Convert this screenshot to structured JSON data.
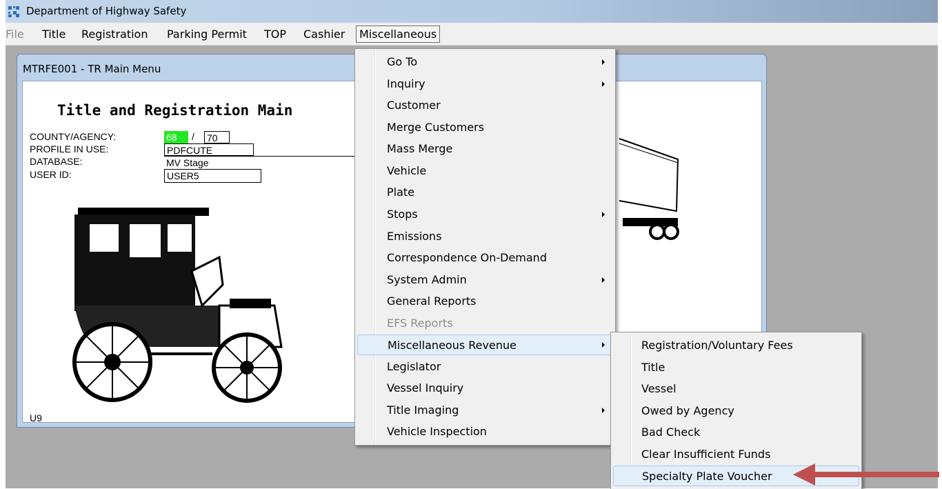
{
  "window": {
    "title": "Department of Highway Safety"
  },
  "menubar": {
    "items": [
      "File",
      "Title",
      "Registration",
      "Parking Permit",
      "TOP",
      "Cashier",
      "Miscellaneous"
    ]
  },
  "child_window": {
    "caption": "MTRFE001 - TR Main Menu",
    "heading": "Title and Registration Main",
    "county_label": "COUNTY/AGENCY:",
    "county_value": "68",
    "separator": "/",
    "agency_value": "70",
    "profile_label": "PROFILE IN USE:",
    "profile_value": "PDFCUTE",
    "database_label": "DATABASE:",
    "database_value": "MV Stage",
    "userid_label": "USER ID:",
    "userid_value": "USER5",
    "status_code": "U9"
  },
  "misc_menu": {
    "items": [
      {
        "label": "Go To",
        "submenu": true
      },
      {
        "label": "Inquiry",
        "submenu": true
      },
      {
        "label": "Customer"
      },
      {
        "label": "Merge Customers"
      },
      {
        "label": "Mass Merge"
      },
      {
        "label": "Vehicle"
      },
      {
        "label": "Plate"
      },
      {
        "label": "Stops",
        "submenu": true
      },
      {
        "label": "Emissions"
      },
      {
        "label": "Correspondence On-Demand"
      },
      {
        "label": "System Admin",
        "submenu": true
      },
      {
        "label": "General Reports"
      },
      {
        "label": "EFS Reports",
        "disabled": true
      },
      {
        "label": "Miscellaneous Revenue",
        "submenu": true,
        "highlighted": true
      },
      {
        "label": "Legislator"
      },
      {
        "label": "Vessel Inquiry"
      },
      {
        "label": "Title Imaging",
        "submenu": true
      },
      {
        "label": "Vehicle Inspection"
      }
    ]
  },
  "revenue_submenu": {
    "items": [
      {
        "label": "Registration/Voluntary Fees"
      },
      {
        "label": "Title"
      },
      {
        "label": "Vessel"
      },
      {
        "label": "Owed by Agency"
      },
      {
        "label": "Bad Check"
      },
      {
        "label": "Clear Insufficient Funds"
      },
      {
        "label": "Specialty Plate Voucher",
        "highlighted": true
      }
    ]
  },
  "colors": {
    "menu_highlight": "#e3eefb",
    "field_green": "#22e722",
    "annotation_arrow": "#c0504d"
  },
  "icons": [
    "app-grid-icon",
    "submenu-arrow-icon",
    "annotation-arrow"
  ]
}
